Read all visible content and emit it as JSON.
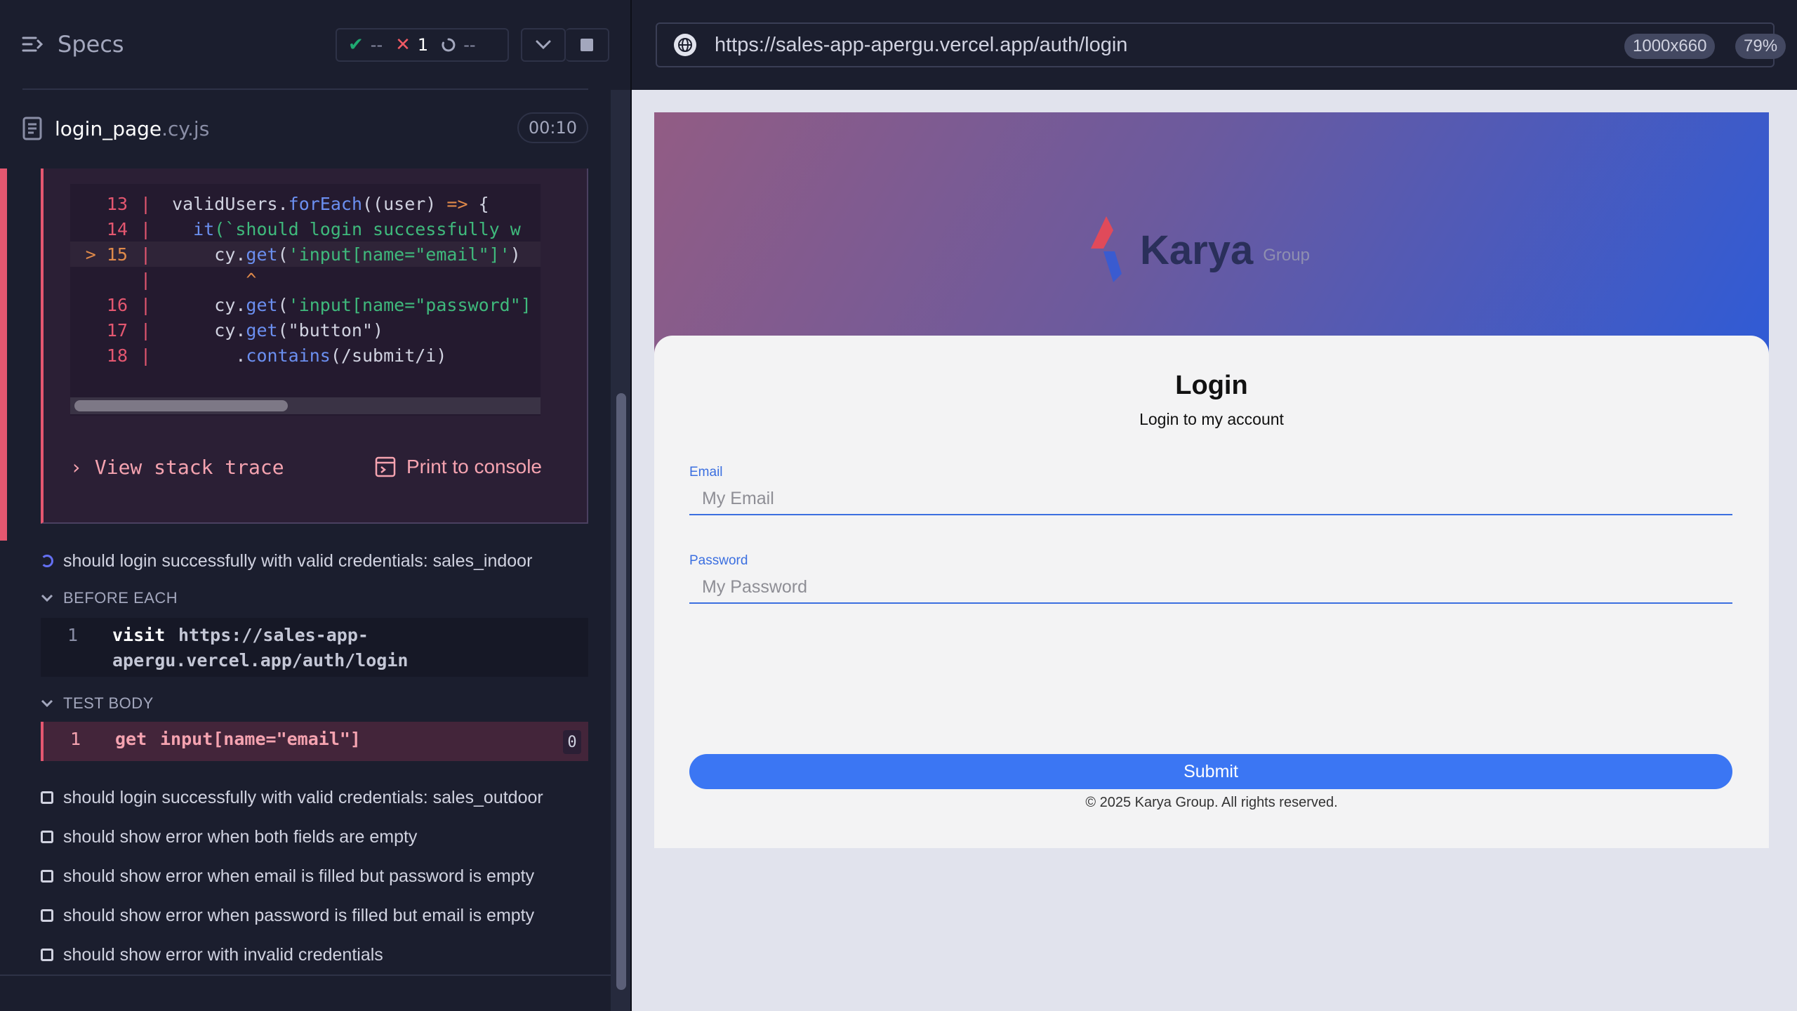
{
  "reporter": {
    "header": {
      "specs_label": "Specs",
      "stats": {
        "passed": "--",
        "failed": "1",
        "pending": "--"
      }
    },
    "spec_file": {
      "name": "login_page",
      "ext": ".cy.js",
      "duration": "00:10"
    },
    "error": {
      "code_lines": [
        {
          "num": "13",
          "text": "validUsers.forEach((user) => {"
        },
        {
          "num": "14",
          "text": "  it(`should login successfully w"
        },
        {
          "num": "> 15",
          "text": "    cy.get('input[name=\"email\"]')"
        },
        {
          "num": "",
          "text": "       ^"
        },
        {
          "num": "16",
          "text": "    cy.get('input[name=\"password\"]"
        },
        {
          "num": "17",
          "text": "    cy.get(\"button\")"
        },
        {
          "num": "18",
          "text": "      .contains(/submit/i)"
        }
      ],
      "view_stack_trace": "View stack trace",
      "print_to_console": "Print to console"
    },
    "current_test": "should login successfully with valid credentials: sales_indoor",
    "before_each": {
      "label": "BEFORE EACH",
      "commands": [
        {
          "index": "1",
          "name": "visit",
          "message": "https://sales-app-",
          "message2": "apergu.vercel.app/auth/login"
        }
      ]
    },
    "test_body": {
      "label": "TEST BODY",
      "commands": [
        {
          "index": "1",
          "name": "get",
          "message": "input[name=\"email\"]",
          "badge": "0"
        }
      ]
    },
    "other_tests": [
      "should login successfully with valid credentials: sales_outdoor",
      "should show error when both fields are empty",
      "should show error when email is filled but password is empty",
      "should show error when password is filled but email is empty",
      "should show error with invalid credentials"
    ]
  },
  "aut": {
    "url": "https://sales-app-apergu.vercel.app/auth/login",
    "viewport": "1000x660",
    "zoom": "79%",
    "app": {
      "logo_text": "Karya",
      "logo_sub": "Group",
      "title": "Login",
      "subtitle": "Login to my account",
      "email_label": "Email",
      "email_placeholder": "My Email",
      "password_label": "Password",
      "password_placeholder": "My Password",
      "submit_label": "Submit",
      "copyright": "© 2025 Karya Group. All rights reserved."
    }
  },
  "colors": {
    "fail": "#e45770",
    "pass": "#1fa971",
    "accent_blue": "#3b76f3",
    "hero_gradient_start": "#925c84",
    "hero_gradient_end": "#2f5bd6"
  }
}
